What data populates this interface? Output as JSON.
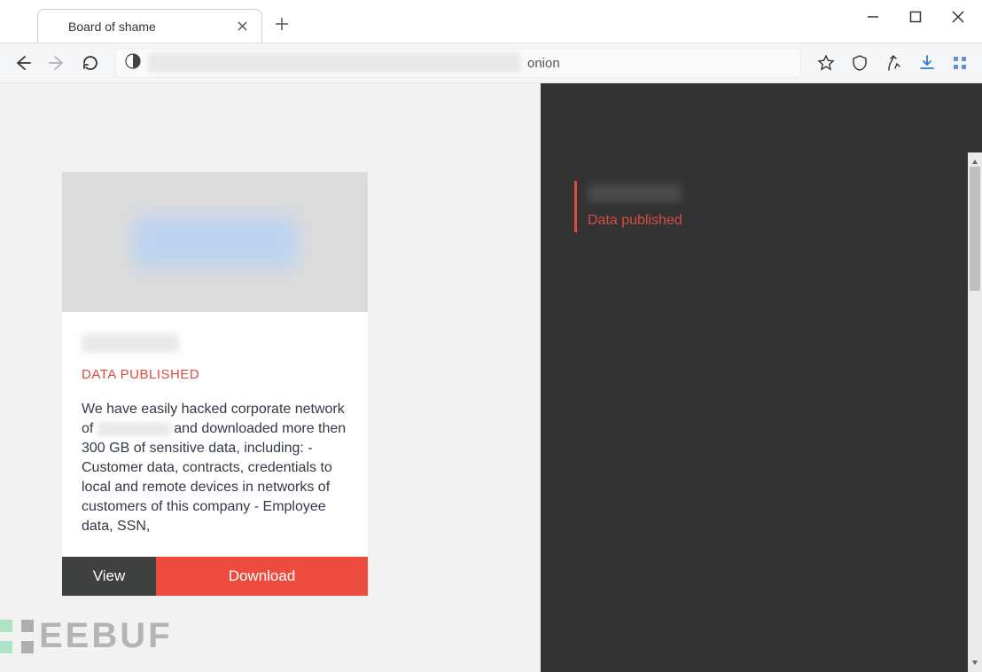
{
  "window": {
    "title": "Board of shame"
  },
  "toolbar": {
    "url_suffix": "onion"
  },
  "site": {
    "header_logo": "trigona-logo"
  },
  "left_card": {
    "status": "DATA PUBLISHED",
    "body_pre": "We have easily hacked corporate network of ",
    "body_post": " and downloaded more then 300 GB of sensitive data, including: - Customer data, contracts, credentials to local and remote devices in networks of customers of this company - Employee data, SSN,",
    "view_label": "View",
    "download_label": "Download"
  },
  "right_item": {
    "status": "Data published"
  },
  "watermark_text": "EEBUF",
  "colors": {
    "accent_red": "#ed4b3e",
    "status_red": "#d94b43",
    "dark_panel": "#333333",
    "brand_green": "#2ecc71"
  }
}
